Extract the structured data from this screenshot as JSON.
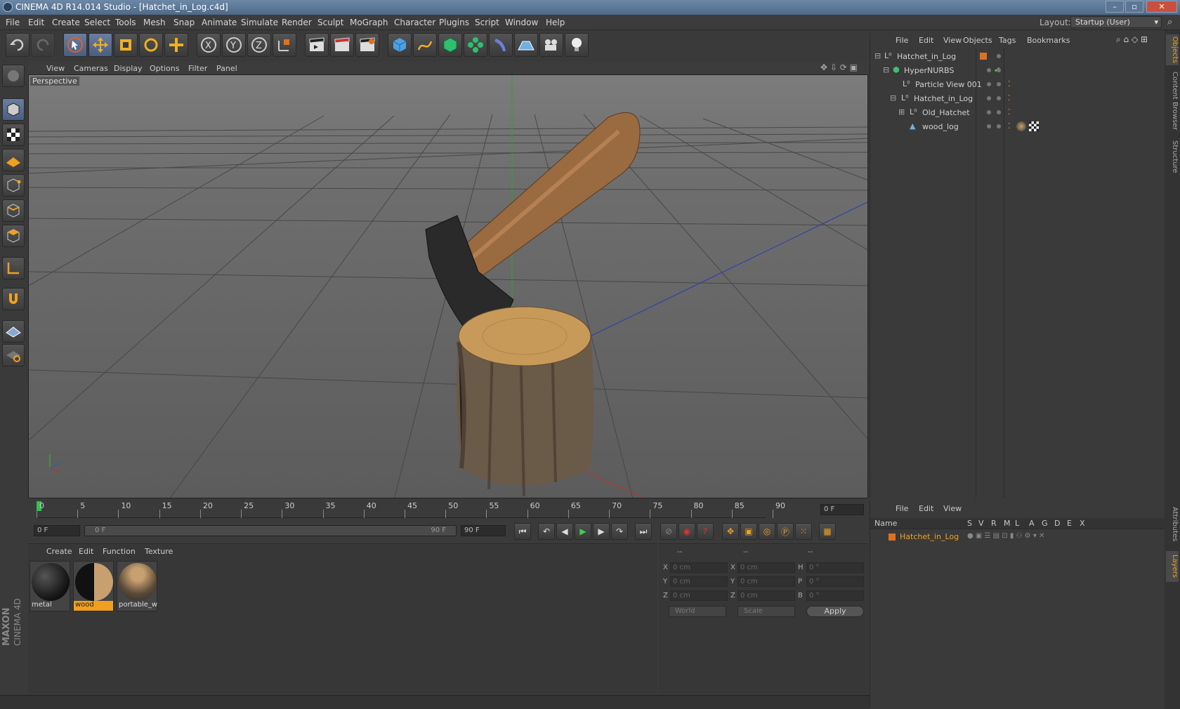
{
  "window": {
    "title": "CINEMA 4D R14.014 Studio - [Hatchet_in_Log.c4d]"
  },
  "menubar": {
    "items": [
      "File",
      "Edit",
      "Create",
      "Select",
      "Tools",
      "Mesh",
      "Snap",
      "Animate",
      "Simulate",
      "Render",
      "Sculpt",
      "MoGraph",
      "Character",
      "Plugins",
      "Script",
      "Window",
      "Help"
    ],
    "layout_label": "Layout:",
    "layout_value": "Startup (User)"
  },
  "viewport": {
    "menu": [
      "View",
      "Cameras",
      "Display",
      "Options",
      "Filter",
      "Panel"
    ],
    "label": "Perspective"
  },
  "timeline": {
    "ticks": [
      "0",
      "5",
      "10",
      "15",
      "20",
      "25",
      "30",
      "35",
      "40",
      "45",
      "50",
      "55",
      "60",
      "65",
      "70",
      "75",
      "80",
      "85",
      "90"
    ],
    "current_frame": "0 F"
  },
  "transport": {
    "start_field": "0 F",
    "range_start": "0 F",
    "range_end": "90 F",
    "end_field": "90 F"
  },
  "material_manager": {
    "menu": [
      "Create",
      "Edit",
      "Function",
      "Texture"
    ],
    "materials": [
      {
        "name": "metal",
        "selected": false
      },
      {
        "name": "wood",
        "selected": true
      },
      {
        "name": "portable_w",
        "selected": false
      }
    ]
  },
  "coordinates": {
    "headers": [
      "--",
      "--",
      "--"
    ],
    "rows": [
      {
        "a_label": "X",
        "a_val": "0 cm",
        "b_label": "X",
        "b_val": "0 cm",
        "c_label": "H",
        "c_val": "0 °"
      },
      {
        "a_label": "Y",
        "a_val": "0 cm",
        "b_label": "Y",
        "b_val": "0 cm",
        "c_label": "P",
        "c_val": "0 °"
      },
      {
        "a_label": "Z",
        "a_val": "0 cm",
        "b_label": "Z",
        "b_val": "0 cm",
        "c_label": "B",
        "c_val": "0 °"
      }
    ],
    "world": "World",
    "scale": "Scale",
    "apply": "Apply"
  },
  "object_manager": {
    "menu": [
      "File",
      "Edit",
      "View",
      "Objects",
      "Tags",
      "Bookmarks"
    ],
    "objects": [
      {
        "name": "Hatchet_in_Log"
      },
      {
        "name": "HyperNURBS"
      },
      {
        "name": "Particle View 001"
      },
      {
        "name": "Hatchet_in_Log"
      },
      {
        "name": "Old_Hatchet"
      },
      {
        "name": "wood_log"
      }
    ]
  },
  "layer_manager": {
    "menu": [
      "File",
      "Edit",
      "View"
    ],
    "columns": [
      "Name",
      "S",
      "V",
      "R",
      "M",
      "L",
      "A",
      "G",
      "D",
      "E",
      "X"
    ],
    "layers": [
      {
        "name": "Hatchet_in_Log"
      }
    ]
  },
  "right_tabs": [
    "Objects",
    "Content Browser",
    "Structure",
    "Attributes",
    "Layers"
  ],
  "branding": {
    "maxon": "MAXON",
    "product": "CINEMA 4D"
  },
  "colors": {
    "accent": "#f0a020",
    "orange": "#e07020",
    "selection_blue": "#5a74a0"
  }
}
